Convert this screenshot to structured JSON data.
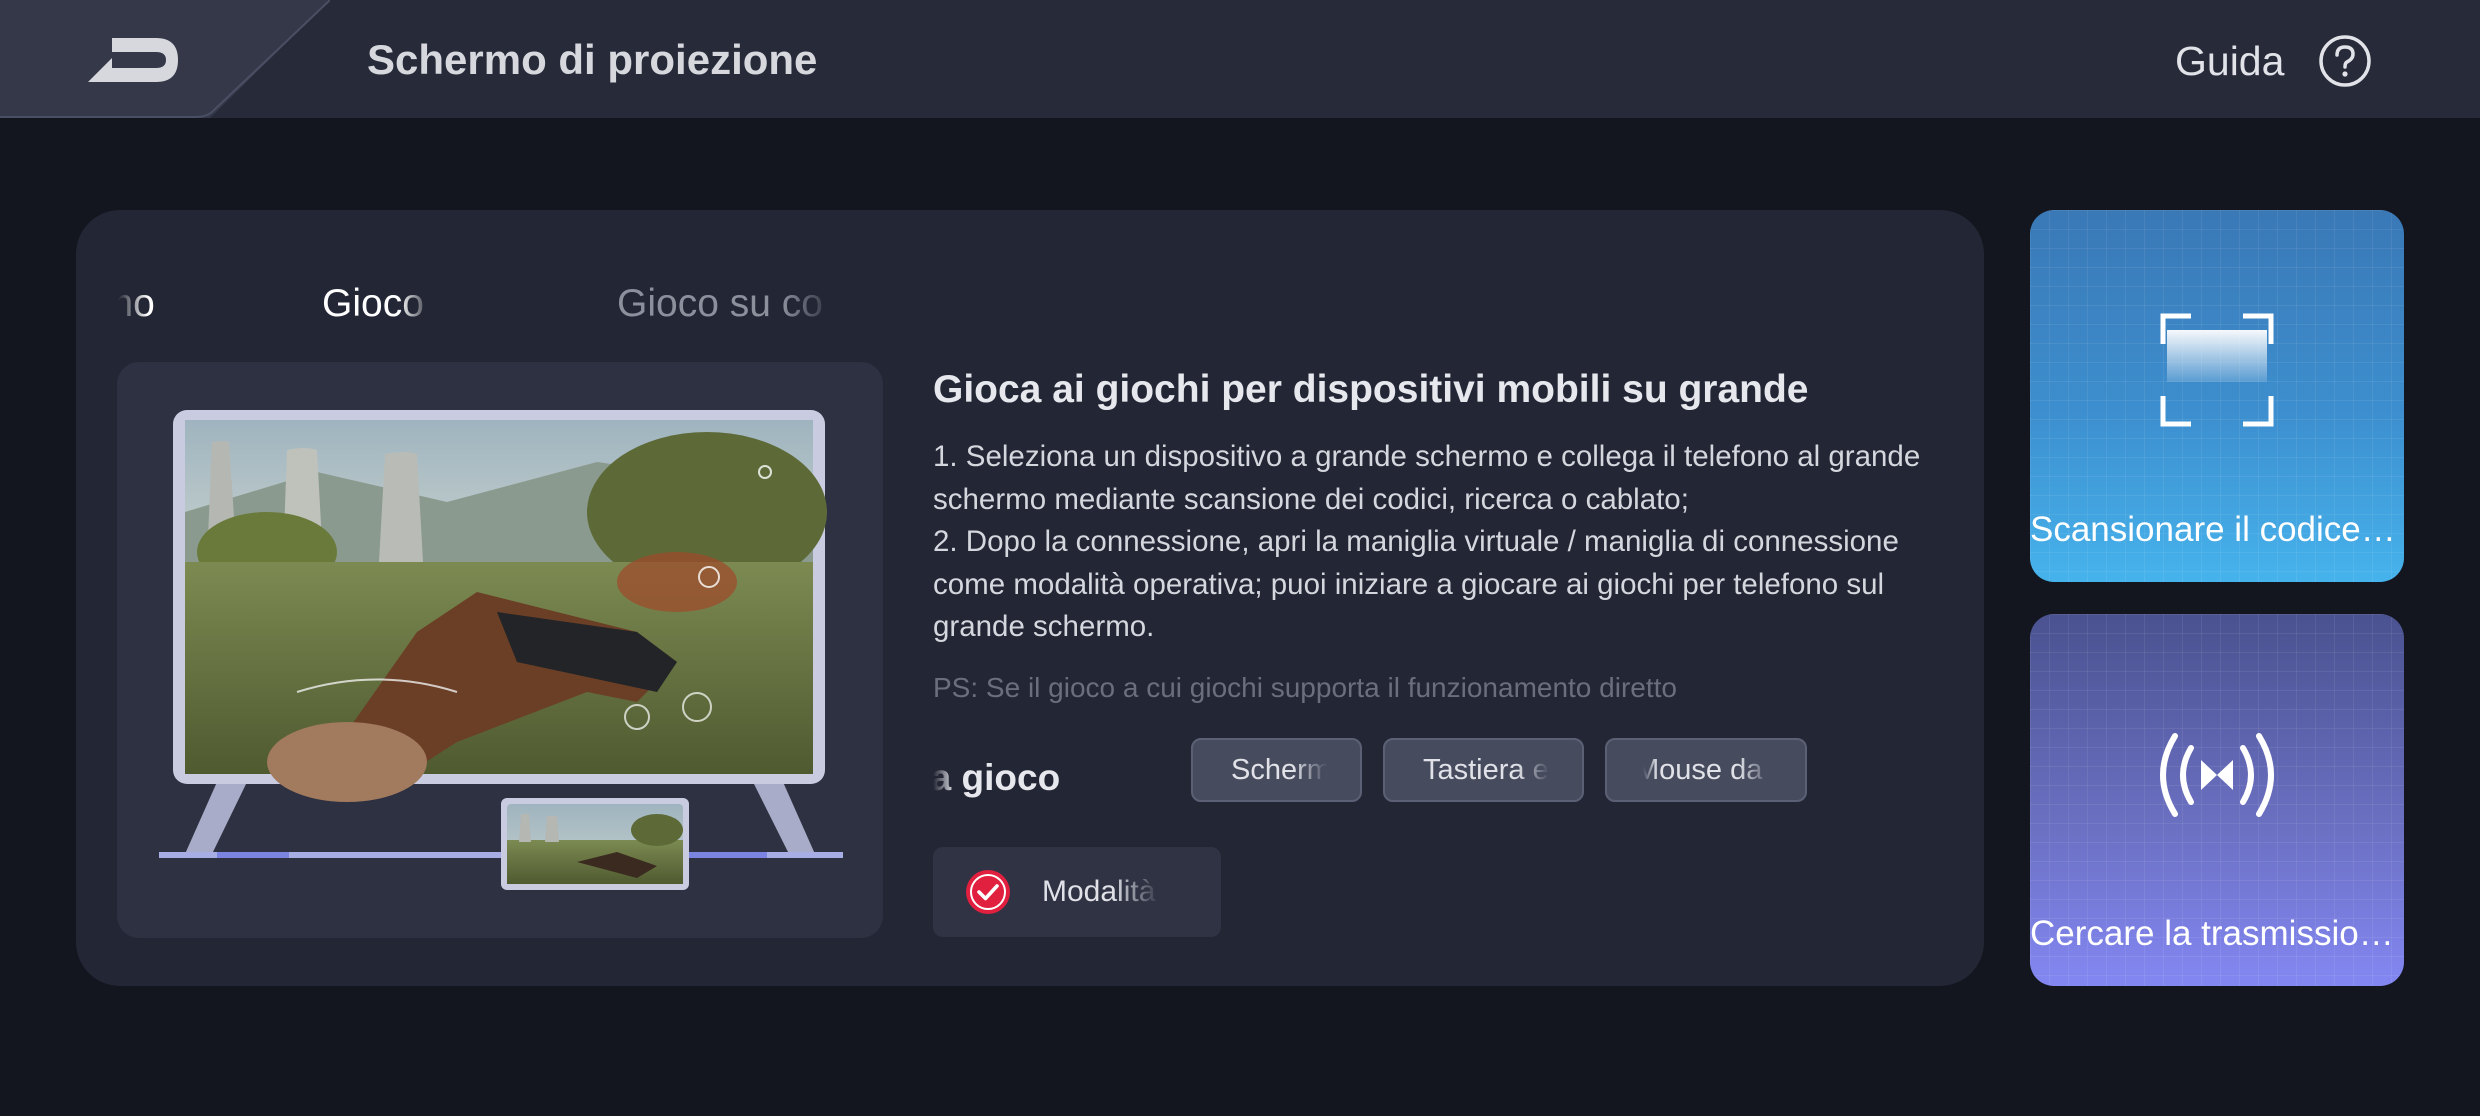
{
  "header": {
    "title": "Schermo di proiezione",
    "help_label": "Guida",
    "back_icon": "back-arrow-icon",
    "help_icon": "question-circle-icon"
  },
  "tabs": [
    {
      "label": "Duplicazione dello schermo",
      "visible_fragment": "ermo"
    },
    {
      "label": "Gioco su grande schermo",
      "visible_fragment": "Gioco"
    },
    {
      "label": "Gioco su computer",
      "visible_fragment": "Gioco su co"
    }
  ],
  "content": {
    "title": "Gioca ai giochi per dispositivi mobili su grande",
    "steps": [
      "1. Seleziona un dispositivo a grande schermo e collega il telefono al grande schermo mediante scansione dei codici, ricerca o cablato;",
      "2. Dopo la connessione, apri la maniglia virtuale / maniglia di connessione come modalità operativa; puoi iniziare a giocare ai giochi per telefono sul grande schermo."
    ],
    "ps": "PS: Se il gioco a cui giochi supporta il funzionamento diretto",
    "mode_label": "Controller da gioco",
    "chips": [
      "Schermo",
      "Tastiera e",
      "Mouse da"
    ],
    "mode_checkbox": {
      "label": "Modalità",
      "checked": true,
      "icon": "check-circle-icon"
    }
  },
  "side_cards": {
    "scan": {
      "label": "Scansionare il codice…",
      "icon": "scan-frame-icon"
    },
    "cast": {
      "label": "Cercare la trasmissio…",
      "icon": "broadcast-waves-icon"
    }
  },
  "colors": {
    "background": "#13161f",
    "header": "#262a39",
    "card": "#232634",
    "accent_red": "#e0203e",
    "scan_gradient": [
      "#3a78b6",
      "#46b3ec"
    ],
    "cast_gradient": [
      "#4a5290",
      "#8387f2"
    ]
  }
}
